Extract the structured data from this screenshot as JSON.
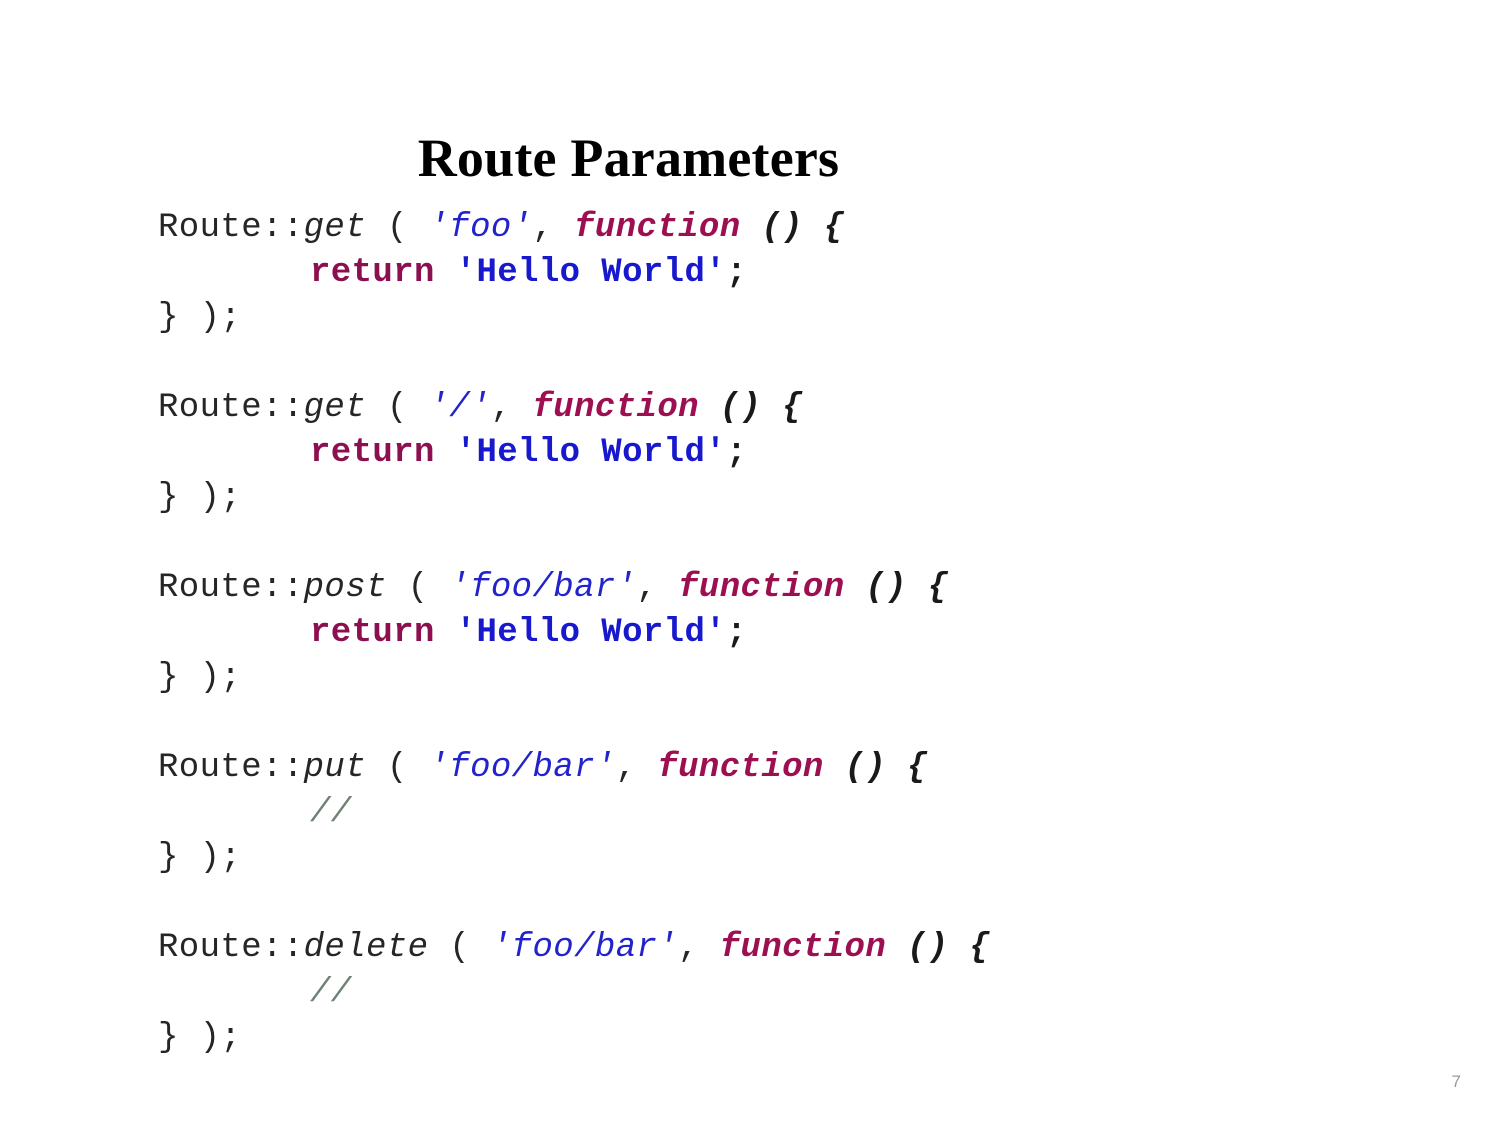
{
  "slide": {
    "title": "Route Parameters",
    "page_number": "7",
    "background_color": "#ffffff"
  },
  "colors": {
    "plain": "#262626",
    "string": "#2323CC",
    "string_bold": "#1818CC",
    "function_keyword": "#9C0F51",
    "return_keyword": "#8C1050",
    "comment": "#6F8273",
    "title": "#000000",
    "page_number": "#9a9a9a"
  },
  "code_blocks": [
    {
      "id": "route-get-foo",
      "lines": [
        {
          "indent": false,
          "tokens": [
            {
              "kind": "plain",
              "text": "Route::"
            },
            {
              "kind": "method",
              "text": "get"
            },
            {
              "kind": "plain",
              "text": " ( "
            },
            {
              "kind": "string",
              "text": "'foo'"
            },
            {
              "kind": "plain",
              "text": ", "
            },
            {
              "kind": "func",
              "text": "function"
            },
            {
              "kind": "plain",
              "text": " "
            },
            {
              "kind": "braces",
              "text": "() {"
            }
          ]
        },
        {
          "indent": true,
          "tokens": [
            {
              "kind": "return",
              "text": "return"
            },
            {
              "kind": "plain",
              "text": " "
            },
            {
              "kind": "strbold",
              "text": "'Hello World'"
            },
            {
              "kind": "semi",
              "text": ";"
            }
          ]
        },
        {
          "indent": false,
          "tokens": [
            {
              "kind": "close",
              "text": "} );"
            }
          ]
        }
      ]
    },
    {
      "id": "route-get-root",
      "lines": [
        {
          "indent": false,
          "tokens": [
            {
              "kind": "plain",
              "text": "Route::"
            },
            {
              "kind": "method",
              "text": "get"
            },
            {
              "kind": "plain",
              "text": " ( "
            },
            {
              "kind": "string",
              "text": "'/'"
            },
            {
              "kind": "plain",
              "text": ", "
            },
            {
              "kind": "func",
              "text": "function"
            },
            {
              "kind": "plain",
              "text": " "
            },
            {
              "kind": "braces",
              "text": "() {"
            }
          ]
        },
        {
          "indent": true,
          "tokens": [
            {
              "kind": "return",
              "text": "return"
            },
            {
              "kind": "plain",
              "text": " "
            },
            {
              "kind": "strbold",
              "text": "'Hello World'"
            },
            {
              "kind": "semi",
              "text": ";"
            }
          ]
        },
        {
          "indent": false,
          "tokens": [
            {
              "kind": "close",
              "text": "} );"
            }
          ]
        }
      ]
    },
    {
      "id": "route-post-foobar",
      "lines": [
        {
          "indent": false,
          "tokens": [
            {
              "kind": "plain",
              "text": "Route::"
            },
            {
              "kind": "method",
              "text": "post"
            },
            {
              "kind": "plain",
              "text": " ( "
            },
            {
              "kind": "string",
              "text": "'foo/bar'"
            },
            {
              "kind": "plain",
              "text": ", "
            },
            {
              "kind": "func",
              "text": "function"
            },
            {
              "kind": "plain",
              "text": " "
            },
            {
              "kind": "braces",
              "text": "() {"
            }
          ]
        },
        {
          "indent": true,
          "tokens": [
            {
              "kind": "return",
              "text": "return"
            },
            {
              "kind": "plain",
              "text": " "
            },
            {
              "kind": "strbold",
              "text": "'Hello World'"
            },
            {
              "kind": "semi",
              "text": ";"
            }
          ]
        },
        {
          "indent": false,
          "tokens": [
            {
              "kind": "close",
              "text": "} );"
            }
          ]
        }
      ]
    },
    {
      "id": "route-put-foobar",
      "lines": [
        {
          "indent": false,
          "tokens": [
            {
              "kind": "plain",
              "text": "Route::"
            },
            {
              "kind": "method",
              "text": "put"
            },
            {
              "kind": "plain",
              "text": " ( "
            },
            {
              "kind": "string",
              "text": "'foo/bar'"
            },
            {
              "kind": "plain",
              "text": ", "
            },
            {
              "kind": "func",
              "text": "function"
            },
            {
              "kind": "plain",
              "text": " "
            },
            {
              "kind": "braces",
              "text": "() {"
            }
          ]
        },
        {
          "indent": true,
          "tokens": [
            {
              "kind": "comment",
              "text": "//"
            }
          ]
        },
        {
          "indent": false,
          "tokens": [
            {
              "kind": "close",
              "text": "} );"
            }
          ]
        }
      ]
    },
    {
      "id": "route-delete-foobar",
      "lines": [
        {
          "indent": false,
          "tokens": [
            {
              "kind": "plain",
              "text": "Route::"
            },
            {
              "kind": "method",
              "text": "delete"
            },
            {
              "kind": "plain",
              "text": " ( "
            },
            {
              "kind": "string",
              "text": "'foo/bar'"
            },
            {
              "kind": "plain",
              "text": ", "
            },
            {
              "kind": "func",
              "text": "function"
            },
            {
              "kind": "plain",
              "text": " "
            },
            {
              "kind": "braces",
              "text": "() {"
            }
          ]
        },
        {
          "indent": true,
          "tokens": [
            {
              "kind": "comment",
              "text": "//"
            }
          ]
        },
        {
          "indent": false,
          "tokens": [
            {
              "kind": "close",
              "text": "} );"
            }
          ]
        }
      ]
    }
  ]
}
